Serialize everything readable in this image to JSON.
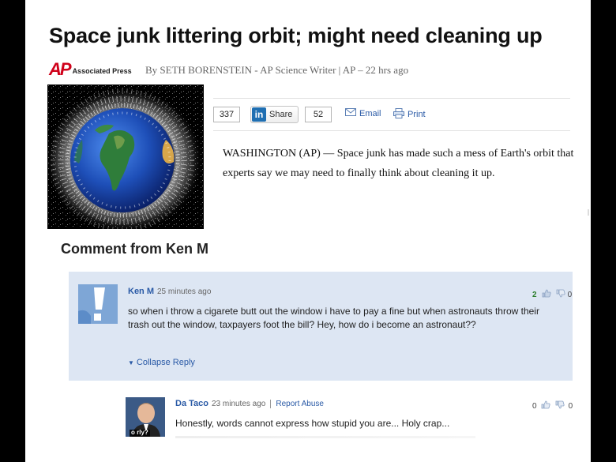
{
  "article": {
    "headline": "Space junk littering orbit; might need cleaning up",
    "source_logo": {
      "mark": "AP",
      "text": "Associated Press"
    },
    "byline": "By SETH BORENSTEIN - AP Science Writer | AP – 22 hrs ago",
    "lead": "WASHINGTON (AP) — Space junk has made such a mess of Earth's orbit that experts say we may need to finally think about cleaning it up."
  },
  "toolbar": {
    "count_left": "337",
    "share_label": "Share",
    "share_count": "52",
    "email_label": "Email",
    "print_label": "Print",
    "icons": {
      "linkedin": "linkedin-icon",
      "email": "envelope-icon",
      "print": "printer-icon"
    }
  },
  "comments": {
    "heading": "Comment from Ken M",
    "main": {
      "author": "Ken M",
      "time": "25 minutes ago",
      "text": "so when i throw a cigarete butt out the window i have to pay a fine but when astronauts throw their trash out the window, taxpayers foot the bill? Hey, how do i become an astronaut??",
      "thumbs_up": "2",
      "thumbs_down": "0",
      "collapse_label": "Collapse Reply"
    },
    "reply": {
      "author": "Da Taco",
      "time": "23 minutes ago",
      "report_label": "Report Abuse",
      "text": "Honestly, words cannot express how stupid you are... Holy crap...",
      "thumbs_up": "0",
      "thumbs_down": "0",
      "avatar_caption": "o rly?"
    }
  },
  "colors": {
    "link": "#2a5aa6",
    "ap_red": "#d0021b",
    "comment_bg": "#dde6f3",
    "earth_ocean": "#1e4fb8",
    "debris": "#e6e6e6"
  }
}
